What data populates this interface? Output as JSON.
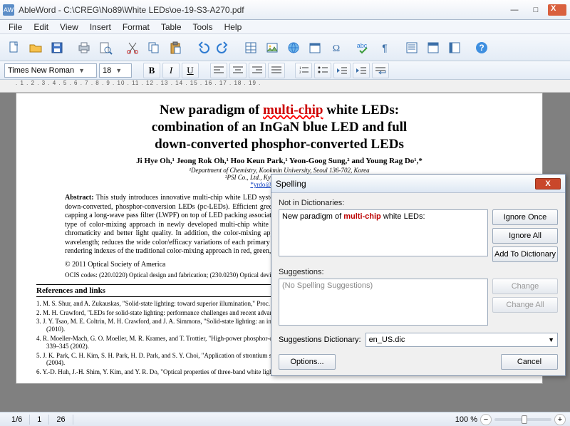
{
  "window": {
    "title": "AbleWord - C:\\CREG\\No89\\White LEDs\\oe-19-S3-A270.pdf",
    "app_icon": "AW"
  },
  "menubar": [
    "File",
    "Edit",
    "View",
    "Insert",
    "Format",
    "Table",
    "Tools",
    "Help"
  ],
  "toolbar_icons": [
    "new",
    "open",
    "save",
    "print",
    "print-preview",
    "cut",
    "copy",
    "paste",
    "undo",
    "redo",
    "table",
    "image",
    "link",
    "date",
    "char",
    "spellcheck",
    "pilcrow",
    "layout1",
    "layout2",
    "layout3",
    "help"
  ],
  "format_bar": {
    "font_family": "Times New Roman",
    "font_size": "18",
    "buttons": [
      "B",
      "I",
      "U"
    ],
    "align_icons": [
      "align-left",
      "align-center",
      "align-right",
      "align-justify",
      "num-list",
      "bul-list",
      "outdent",
      "indent",
      "word-wrap"
    ]
  },
  "ruler_text": ". 1 . 2 . 3 . 4 . 5 . 6 . 7 . 8 . 9 . 10 . 11 . 12 . 13 . 14 . 15 . 16 . 17 . 18 . 19 .",
  "document": {
    "title_line1": "New paradigm of ",
    "title_redword": "multi-chip",
    "title_line1b": " white LEDs:",
    "title_line2": "combination of an InGaN blue LED and full",
    "title_line3": "down-converted phosphor-converted LEDs",
    "authors": "Ji Hye Oh,¹ Jeong Rok Oh,¹ Hoo Keun Park,¹ Yeon-Goog Sung,² and Young Rag Do¹,*",
    "affil1": "¹Department of Chemistry, Kookmin University, Seoul 136-702, Korea",
    "affil2": "²PSI Co., Ltd., Kyunki-Do 442-160, Korea",
    "email": "*yrdo@kookmin.ac.kr",
    "abstract": "Abstract: This study introduces innovative multi-chip white LED systems that combine an InGaN blue LED and green/red or green/amber/red full down-converted, phosphor-conversion LEDs (pc-LEDs). Efficient green, amber, and red full down-converted pc-LEDs were fabricated by simply capping a long-wave pass filter (LWPF) on top of LED packing associated with each corresponding powder phosphor. The principal advantage of this type of color-mixing approach in newly developed multi-chip white LEDs based on colored pc-LEDs is thought to be dynamic control of the chromaticity and better light quality. In addition, the color-mixing approach improves the low efficacy of green/amber LEDs in the \"green gap\" wavelength; reduces the wide color/efficacy variations of each primary LED with at different temperatures and currents; and improves the low color rendering indexes of the traditional color-mixing approach in red, green, and blue (RGB) multi-chip white LEDs.",
    "copyright": "© 2011 Optical Society of America",
    "ocis": "OCIS codes: (220.0220) Optical design and fabrication; (230.0230) Optical devices; (230.1480) Bragg reflectors; (230.3670) Light-emitting diodes.",
    "refs_header": "References and links",
    "refs": [
      "1.  M. S. Shur, and A. Zukauskas, \"Solid-state lighting: toward superior illumination,\" Proc. IEEE 93(10), 1691–1703 (2005).",
      "2.  M. H. Crawford, \"LEDs for solid-state lighting: performance challenges and recent advances,\" IEEE J. Sel. Top. Quantum Electron. 15(4), 1028–1040 (2009).",
      "3.  J. Y. Tsao, M. E. Coltrin, M. H. Crawford, and J. A. Simmons, \"Solid-state lighting: an integrated human factors, technology, and economic perspective,\" Proc. IEEE 98(7), 1162–1179 (2010).",
      "4.  R. Moeller-Mach, G. O. Moeller, M. R. Krames, and T. Trottier, \"High-power phosphor-converted light-emitting diodes based on III-Nitrides,\" IEEE J. Sel. Top. Quantum Electron. 8(2), 339–345 (2002).",
      "5.  J. K. Park, C. H. Kim, S. H. Park, H. D. Park, and S. Y. Choi, \"Application of strontium silicate yellow phosphor for white light-emitting diodes,\" Appl. Phys. Lett. 84(10), 1647–1649 (2004).",
      "6.  Y.-D. Huh, J.-H. Shim, Y. Kim, and Y. R. Do, \"Optical properties of three-band white light emitting diodes,\" J."
    ]
  },
  "dialog": {
    "title": "Spelling",
    "not_in_dict_label": "Not in Dictionaries:",
    "context_pre": "New paradigm of ",
    "context_word": "multi-chip",
    "context_post": " white LEDs:",
    "suggestions_label": "Suggestions:",
    "no_suggestions": "(No Spelling Suggestions)",
    "dict_label": "Suggestions Dictionary:",
    "dict_value": "en_US.dic",
    "btn_ignore_once": "Ignore Once",
    "btn_ignore_all": "Ignore All",
    "btn_add": "Add To Dictionary",
    "btn_change": "Change",
    "btn_change_all": "Change All",
    "btn_options": "Options...",
    "btn_cancel": "Cancel"
  },
  "status": {
    "page": "1/6",
    "tabs": [
      "1",
      "26"
    ],
    "zoom": "100 %"
  }
}
